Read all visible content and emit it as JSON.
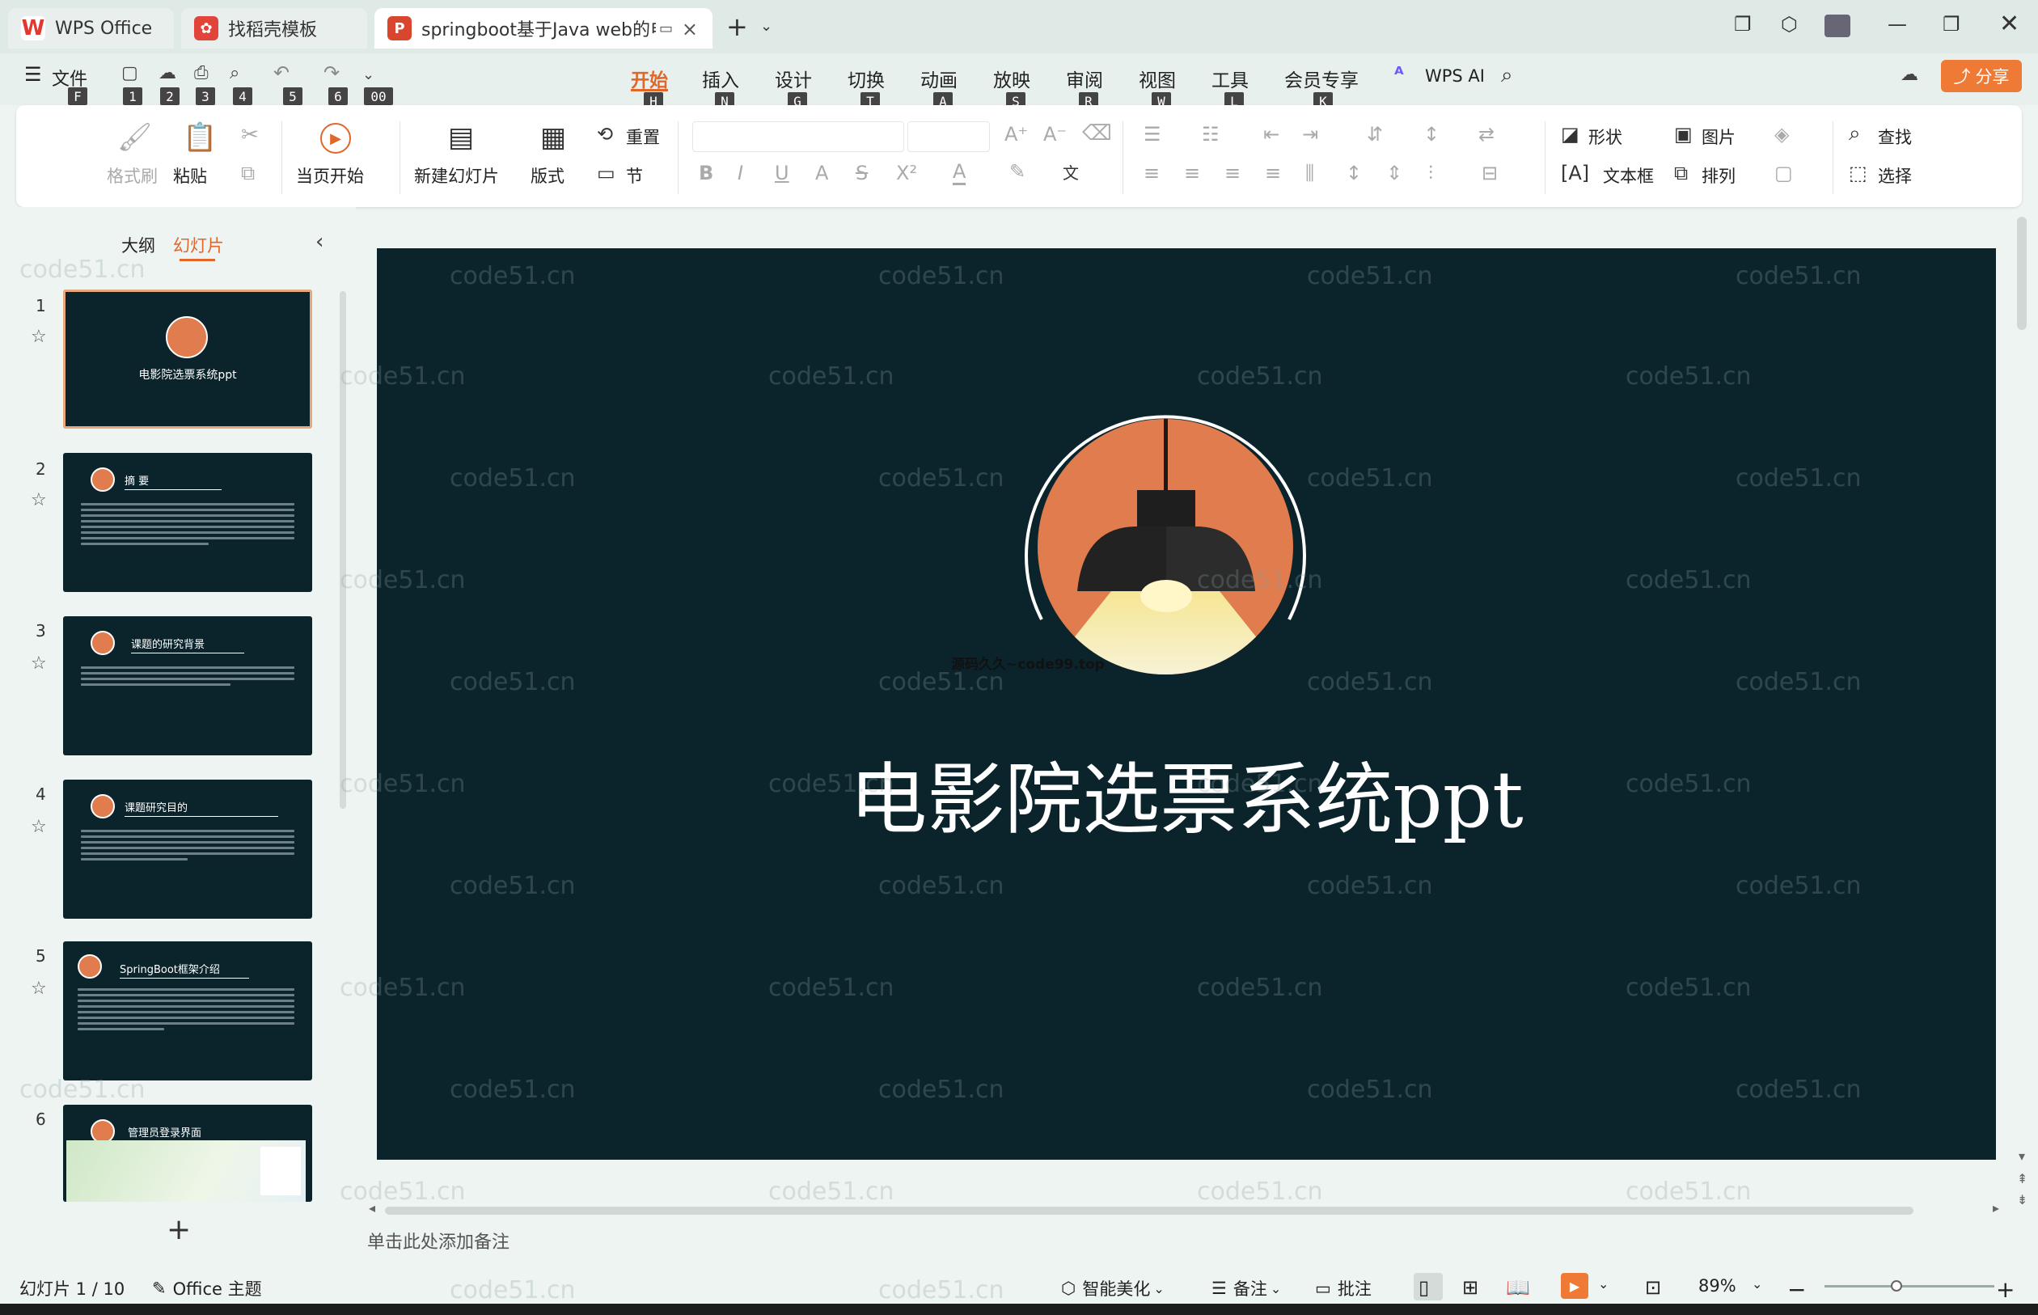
{
  "tabs": [
    {
      "label": "WPS Office",
      "icon": "wps-logo-icon"
    },
    {
      "label": "找稻壳模板",
      "icon": "docer-icon"
    },
    {
      "label": "springboot基于Java web的电",
      "icon": "ppt-icon",
      "active": true
    }
  ],
  "menu": {
    "file": "文件",
    "quick_keys": [
      "F",
      "1",
      "2",
      "3",
      "4",
      "5",
      "6",
      "00"
    ],
    "tabs": [
      {
        "label": "开始",
        "key": "H",
        "active": true
      },
      {
        "label": "插入",
        "key": "N"
      },
      {
        "label": "设计",
        "key": "G"
      },
      {
        "label": "切换",
        "key": "T"
      },
      {
        "label": "动画",
        "key": "A"
      },
      {
        "label": "放映",
        "key": "S"
      },
      {
        "label": "审阅",
        "key": "R"
      },
      {
        "label": "视图",
        "key": "W"
      },
      {
        "label": "工具",
        "key": "L"
      },
      {
        "label": "会员专享",
        "key": "K"
      }
    ],
    "wps_ai": "WPS AI",
    "share": "分享"
  },
  "ribbon": {
    "format_painter": "格式刷",
    "paste": "粘贴",
    "play_from_current": "当页开始",
    "new_slide": "新建幻灯片",
    "layout": "版式",
    "reset": "重置",
    "section": "节",
    "shape": "形状",
    "picture": "图片",
    "find": "查找",
    "textbox": "文本框",
    "arrange": "排列",
    "select": "选择"
  },
  "panel": {
    "outline_tab": "大纲",
    "slides_tab": "幻灯片",
    "thumbs": [
      {
        "num": "1",
        "title": "电影院选票系统ppt"
      },
      {
        "num": "2",
        "title": "摘    要"
      },
      {
        "num": "3",
        "title": "课题的研究背景"
      },
      {
        "num": "4",
        "title": "课题研究目的"
      },
      {
        "num": "5",
        "title": "SpringBoot框架介绍"
      },
      {
        "num": "6",
        "title": "管理员登录界面"
      }
    ]
  },
  "slide": {
    "title": "电影院选票系统ppt",
    "small_caption": "源码久久~code99.top"
  },
  "watermark": "code51.cn",
  "notes_placeholder": "单击此处添加备注",
  "status": {
    "slide_counter": "幻灯片 1 / 10",
    "theme": "Office 主题",
    "smart_beautify": "智能美化",
    "notes": "备注",
    "comments": "批注",
    "zoom": "89%"
  },
  "colors": {
    "accent_orange": "#e07c4e",
    "slide_bg": "#0b242c",
    "share_bg": "#ee7a35"
  }
}
